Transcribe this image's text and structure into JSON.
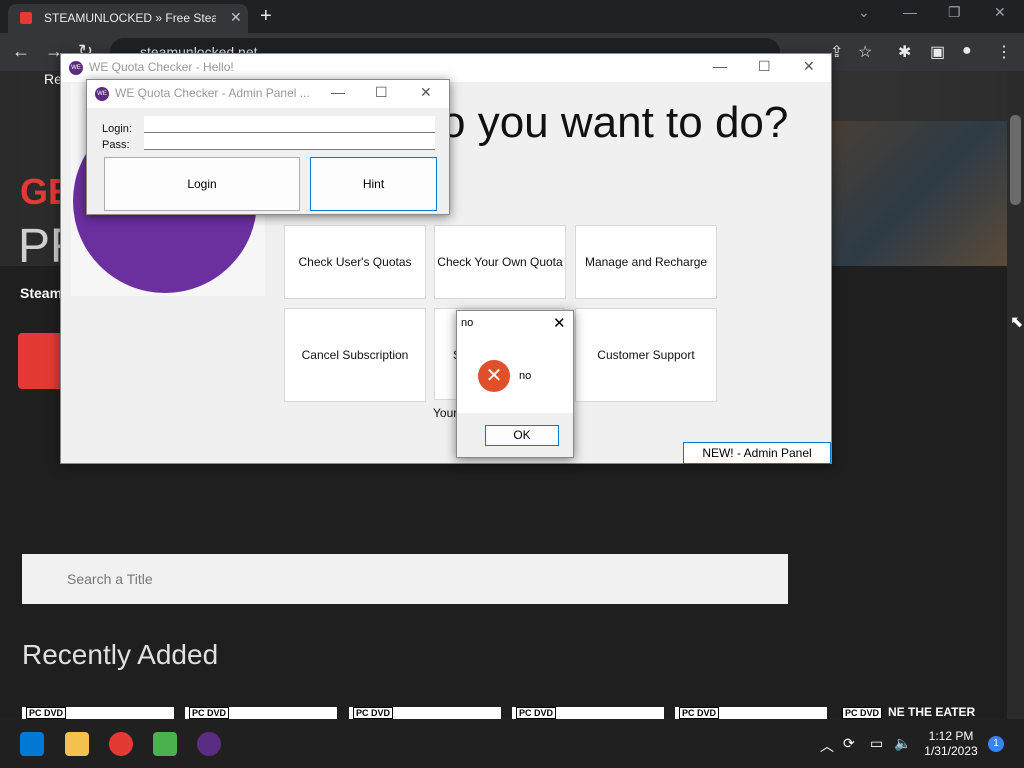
{
  "browser": {
    "tab_title": "STEAMUNLOCKED » Free Steam G",
    "tab_close": "✕",
    "new_tab": "+",
    "url": "steamunlocked.net",
    "win_minimize": "—",
    "win_restore": "❐",
    "win_close": "✕"
  },
  "page": {
    "hero_re": "Re",
    "hero_gen": "GE",
    "hero_pr": "PR",
    "hero_steam": "Steam",
    "search_placeholder": "Search a Title",
    "recently_added": "Recently Added",
    "thumb_label": "PC DVD",
    "thumb_last_text": "NE THE EATER"
  },
  "main_window": {
    "title": "WE Quota Checker - Hello!",
    "question": "o you want to do?",
    "tiles": [
      "Check User's Quotas",
      "Check Your Own Quota",
      "Manage and Recharge",
      "Cancel Subscription",
      "S",
      "Customer Support"
    ],
    "your_text": "Your",
    "admin_button": "NEW! - Admin Panel",
    "icon_text": "WE"
  },
  "admin_window": {
    "title": "WE Quota Checker - Admin Panel ...",
    "login_label": "Login:",
    "pass_label": "Pass:",
    "login_value": "",
    "pass_value": "",
    "login_button": "Login",
    "hint_button": "Hint"
  },
  "message_box": {
    "title": "no",
    "text": "no",
    "ok_button": "OK"
  },
  "taskbar": {
    "time": "1:12 PM",
    "date": "1/31/2023",
    "notification_count": "1"
  }
}
